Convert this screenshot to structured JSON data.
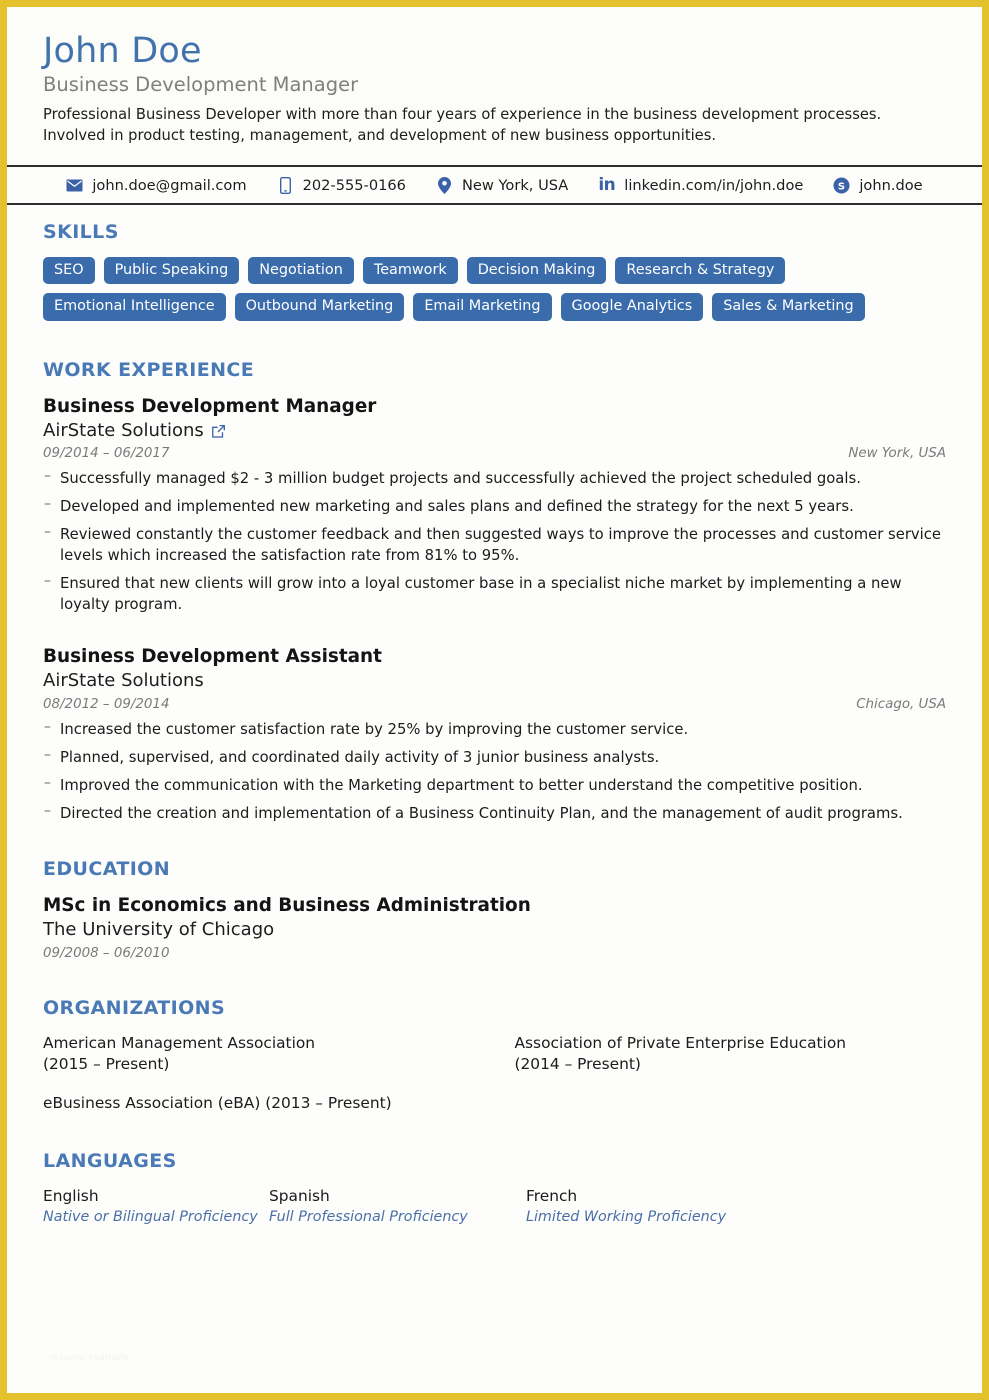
{
  "theme": {
    "page_border": "#e3c22e",
    "accent_blue": "#4a7ab5",
    "name_blue": "#4272ad",
    "tag_blue": "#3a6cab",
    "icon_blue": "#3a62a8",
    "muted_gray": "#7f7f7f",
    "background": "#fdfdfb"
  },
  "header": {
    "name": "John Doe",
    "job_title": "Business Development Manager",
    "summary": "Professional Business Developer with more than four years of experience in the business development processes. Involved in product testing, management, and development of new business opportunities."
  },
  "contact": [
    {
      "icon": "envelope-icon",
      "label": "john.doe@gmail.com"
    },
    {
      "icon": "phone-icon",
      "label": "202-555-0166"
    },
    {
      "icon": "location-pin-icon",
      "label": "New York, USA"
    },
    {
      "icon": "linkedin-icon",
      "label": "linkedin.com/in/john.doe"
    },
    {
      "icon": "skype-icon",
      "label": "john.doe"
    }
  ],
  "skills": {
    "title": "SKILLS",
    "rows": [
      [
        "SEO",
        "Public Speaking",
        "Negotiation",
        "Teamwork",
        "Decision Making",
        "Research & Strategy"
      ],
      [
        "Emotional Intelligence",
        "Outbound Marketing",
        "Email Marketing",
        "Google Analytics",
        "Sales & Marketing"
      ]
    ]
  },
  "work": {
    "title": "WORK EXPERIENCE",
    "jobs": [
      {
        "role": "Business Development Manager",
        "company": "AirState Solutions",
        "has_link": true,
        "link_icon": "external-link-icon",
        "dates": "09/2014 – 06/2017",
        "location": "New York, USA",
        "bullets": [
          "Successfully managed $2 - 3 million budget projects and successfully achieved the project scheduled goals.",
          "Developed and implemented new marketing and sales plans and defined the strategy for the next 5 years.",
          "Reviewed constantly the customer feedback and then suggested ways to improve the processes and customer service levels which increased the satisfaction rate from 81% to 95%.",
          "Ensured that new clients will grow into a loyal customer base in a specialist niche market by implementing a new loyalty program."
        ]
      },
      {
        "role": "Business Development Assistant",
        "company": "AirState Solutions",
        "has_link": false,
        "dates": "08/2012 – 09/2014",
        "location": "Chicago, USA",
        "bullets": [
          "Increased the customer satisfaction rate by 25% by improving the customer service.",
          "Planned, supervised, and coordinated daily activity of 3 junior business analysts.",
          "Improved the communication with the Marketing department to better understand the competitive position.",
          "Directed the creation and implementation of a Business Continuity Plan, and the management of audit programs."
        ]
      }
    ]
  },
  "education": {
    "title": "EDUCATION",
    "entries": [
      {
        "degree": "MSc in Economics and Business Administration",
        "school": "The University of Chicago",
        "dates": "09/2008 – 06/2010"
      }
    ]
  },
  "organizations": {
    "title": "ORGANIZATIONS",
    "items": [
      "American Management Association\n(2015 – Present)",
      "Association of Private Enterprise Education\n(2014 – Present)",
      "eBusiness Association (eBA) (2013 – Present)",
      ""
    ]
  },
  "languages": {
    "title": "LANGUAGES",
    "items": [
      {
        "name": "English",
        "level": "Native or Bilingual Proficiency"
      },
      {
        "name": "Spanish",
        "level": "Full Professional Proficiency"
      },
      {
        "name": "French",
        "level": "Limited Working Proficiency"
      }
    ]
  },
  "watermark": "resume-example"
}
